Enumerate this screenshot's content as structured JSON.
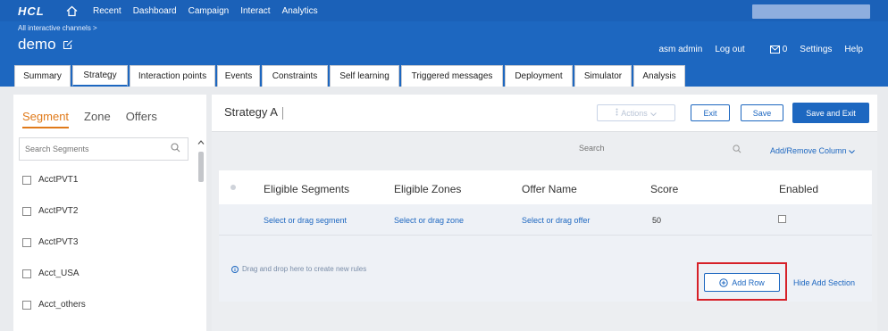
{
  "topnav": {
    "logo": "HCL",
    "items": [
      "Recent",
      "Dashboard",
      "Campaign",
      "Interact",
      "Analytics"
    ]
  },
  "header": {
    "breadcrumb": "All interactive channels >",
    "title": "demo",
    "user": "asm admin",
    "logout": "Log out",
    "mail_count": "0",
    "settings": "Settings",
    "help": "Help"
  },
  "tabs": [
    "Summary",
    "Strategy",
    "Interaction points",
    "Events",
    "Constraints",
    "Self learning",
    "Triggered messages",
    "Deployment",
    "Simulator",
    "Analysis"
  ],
  "left": {
    "subtabs": [
      "Segment",
      "Zone",
      "Offers"
    ],
    "search_placeholder": "Search Segments",
    "segments": [
      "AcctPVT1",
      "AcctPVT2",
      "AcctPVT3",
      "Acct_USA",
      "Acct_others"
    ]
  },
  "main": {
    "title": "Strategy A",
    "actions_label": "Actions",
    "exit_label": "Exit",
    "save_label": "Save",
    "save_exit_label": "Save and Exit",
    "search_placeholder": "Search",
    "add_remove_column": "Add/Remove Column",
    "columns": [
      "Eligible Segments",
      "Eligible Zones",
      "Offer Name",
      "Score",
      "Enabled"
    ],
    "row": {
      "segment": "Select or drag segment",
      "zone": "Select or drag zone",
      "offer": "Select or drag offer",
      "score": "50"
    },
    "drop_hint": "Drag and drop here to create new rules",
    "add_row": "Add Row",
    "hide_add_section": "Hide Add Section"
  },
  "colors": {
    "brand_blue": "#1d67c0",
    "accent_orange": "#e07a1a",
    "highlight_red": "#d62028"
  }
}
